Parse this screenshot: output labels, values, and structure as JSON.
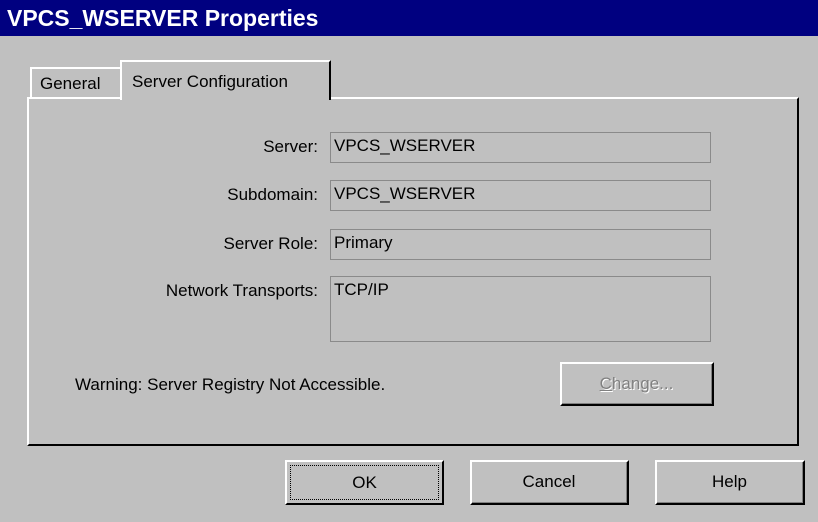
{
  "window": {
    "title": "VPCS_WSERVER Properties"
  },
  "tabs": [
    {
      "label": "General",
      "selected": false
    },
    {
      "label": "Server Configuration",
      "selected": true
    }
  ],
  "server_config": {
    "server_label": "Server:",
    "server_value": "VPCS_WSERVER",
    "subdomain_label": "Subdomain:",
    "subdomain_value": "VPCS_WSERVER",
    "role_label": "Server Role:",
    "role_value": "Primary",
    "transports_label": "Network Transports:",
    "transports_value": "TCP/IP",
    "warning": "Warning: Server Registry Not Accessible.",
    "change_button": "Change..."
  },
  "buttons": {
    "ok": "OK",
    "cancel": "Cancel",
    "help": "Help"
  },
  "colors": {
    "titlebar": "#000080",
    "face": "#c0c0c0",
    "disabled_text": "#808080"
  }
}
